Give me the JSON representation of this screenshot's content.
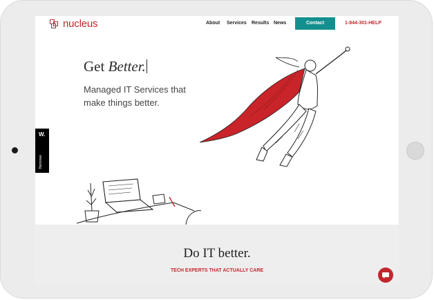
{
  "brand": {
    "logo_text": "nucleus",
    "accent": "#c0282d",
    "teal": "#148f8f"
  },
  "nav": {
    "links": [
      "About",
      "Services",
      "Results",
      "News"
    ],
    "contact_label": "Contact",
    "phone": "1-844-301-HELP"
  },
  "hero": {
    "title_plain": "Get ",
    "title_italic": "Better.",
    "subtitle": "Managed IT Services that make things better."
  },
  "badge": {
    "letter": "W.",
    "label": "Nominee"
  },
  "section": {
    "title": "Do IT better.",
    "subtitle": "TECH EXPERTS THAT ACTUALLY CARE"
  },
  "icons": {
    "chat": "chat-bubble-icon",
    "logo": "nucleus-logo-icon"
  }
}
